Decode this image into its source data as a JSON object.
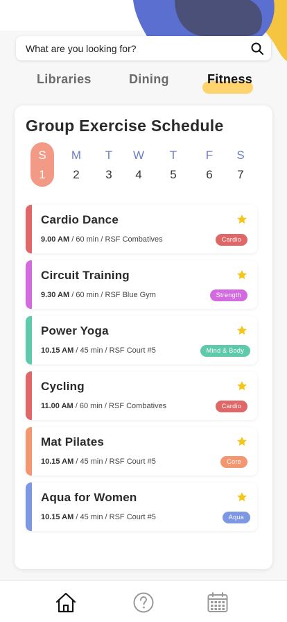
{
  "search": {
    "placeholder": "What are you looking for?"
  },
  "tabs": [
    "Libraries",
    "Dining",
    "Fitness"
  ],
  "active_tab": "Fitness",
  "schedule": {
    "title": "Group Exercise Schedule",
    "days": [
      {
        "letter": "S",
        "num": "1",
        "selected": true
      },
      {
        "letter": "M",
        "num": "2"
      },
      {
        "letter": "T",
        "num": "3"
      },
      {
        "letter": "W",
        "num": "4"
      },
      {
        "letter": "T",
        "num": "5"
      },
      {
        "letter": "F",
        "num": "6"
      },
      {
        "letter": "S",
        "num": "7"
      }
    ],
    "classes": [
      {
        "name": "Cardio Dance",
        "time": "9.00 AM",
        "details": "/ 60 min / RSF Combatives",
        "tag": "Cardio",
        "color": "#e06767",
        "starred": true
      },
      {
        "name": "Circuit Training",
        "time": "9.30 AM",
        "details": "/ 60 min / RSF Blue Gym",
        "tag": "Strength",
        "color": "#d36ae0",
        "starred": true
      },
      {
        "name": "Power Yoga",
        "time": "10.15 AM",
        "details": "/ 45 min / RSF Court #5",
        "tag": "Mind & Body",
        "color": "#5ecaab",
        "starred": true
      },
      {
        "name": "Cycling",
        "time": "11.00 AM",
        "details": "/ 60 min / RSF Combatives",
        "tag": "Cardio",
        "color": "#e06767",
        "starred": true
      },
      {
        "name": "Mat Pilates",
        "time": "10.15 AM",
        "details": "/ 45 min / RSF Court #5",
        "tag": "Core",
        "color": "#f2976f",
        "starred": true
      },
      {
        "name": "Aqua for Women",
        "time": "10.15 AM",
        "details": "/ 45 min / RSF Court #5",
        "tag": "Aqua",
        "color": "#7d98e3",
        "starred": true
      }
    ]
  },
  "bottom_nav": [
    "home-icon",
    "help-icon",
    "calendar-icon"
  ],
  "colors": {
    "accent_yellow": "#ffd36e",
    "selected_day": "#f29a85",
    "star": "#f5c518",
    "blob_dark": "#4a5078",
    "blob_blue": "#5a6fd0",
    "blob_yellow": "#f5c542"
  }
}
